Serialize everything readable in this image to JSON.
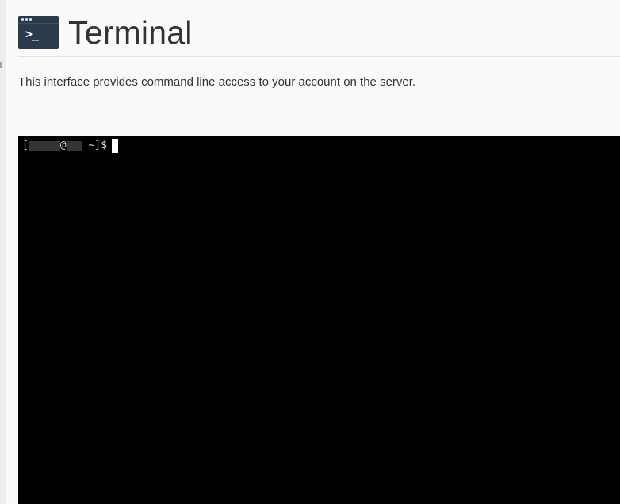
{
  "page": {
    "title": "Terminal",
    "description": "This interface provides command line access to your account on the server."
  },
  "app_icon": {
    "name": "terminal-app-icon",
    "glyph": ">_"
  },
  "terminal": {
    "prompt_open": "[",
    "prompt_at": "@",
    "prompt_dir": " ~]",
    "prompt_symbol": "$",
    "background": "#000000",
    "text_color": "#d4d4d4"
  },
  "colors": {
    "icon_background": "#293a4a",
    "page_background": "#fafafa",
    "title_text": "#333333"
  }
}
